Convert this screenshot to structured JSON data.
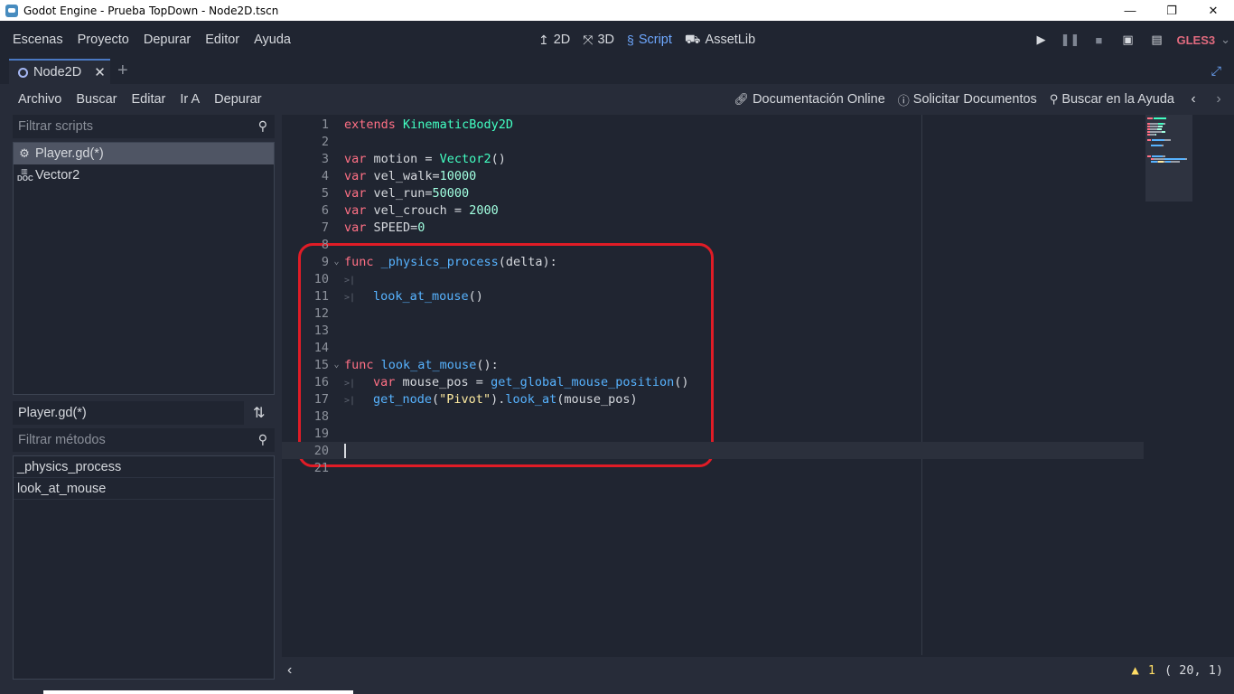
{
  "window": {
    "title": "Godot Engine - Prueba TopDown - Node2D.tscn",
    "controls": [
      "—",
      "❐",
      "✕"
    ]
  },
  "main_menu": [
    "Escenas",
    "Proyecto",
    "Depurar",
    "Editor",
    "Ayuda"
  ],
  "workspaces": [
    {
      "label": "2D",
      "icon": "2d-icon",
      "glyph": "↥"
    },
    {
      "label": "3D",
      "icon": "3d-icon",
      "glyph": "⤧"
    },
    {
      "label": "Script",
      "icon": "script-icon",
      "glyph": "§",
      "active": true
    },
    {
      "label": "AssetLib",
      "icon": "assetlib-icon",
      "glyph": "⛟"
    }
  ],
  "renderer": "GLES3",
  "scene_tab": {
    "name": "Node2D"
  },
  "script_menu": [
    "Archivo",
    "Buscar",
    "Editar",
    "Ir A",
    "Depurar"
  ],
  "help_links": {
    "online_docs": "Documentación Online",
    "request_docs": "Solicitar Documentos",
    "search_help": "Buscar en la Ayuda"
  },
  "scripts_panel": {
    "filter_placeholder": "Filtrar scripts",
    "items": [
      {
        "label": "Player.gd(*)",
        "icon": "gear-icon",
        "selected": true
      },
      {
        "label": "Vector2",
        "icon": "doc-icon",
        "selected": false
      }
    ]
  },
  "methods_panel": {
    "current_script": "Player.gd(*)",
    "filter_placeholder": "Filtrar métodos",
    "items": [
      "_physics_process",
      "look_at_mouse"
    ]
  },
  "code_lines": [
    {
      "n": "1",
      "tokens": [
        [
          "kw",
          "extends"
        ],
        [
          "plain",
          " "
        ],
        [
          "ty",
          "KinematicBody2D"
        ]
      ]
    },
    {
      "n": "2",
      "tokens": []
    },
    {
      "n": "3",
      "tokens": [
        [
          "kw",
          "var"
        ],
        [
          "plain",
          " motion = "
        ],
        [
          "ty",
          "Vector2"
        ],
        [
          "plain",
          "()"
        ]
      ]
    },
    {
      "n": "4",
      "tokens": [
        [
          "kw",
          "var"
        ],
        [
          "plain",
          " vel_walk="
        ],
        [
          "num",
          "10000"
        ]
      ]
    },
    {
      "n": "5",
      "tokens": [
        [
          "kw",
          "var"
        ],
        [
          "plain",
          " vel_run="
        ],
        [
          "num",
          "50000"
        ]
      ]
    },
    {
      "n": "6",
      "tokens": [
        [
          "kw",
          "var"
        ],
        [
          "plain",
          " vel_crouch = "
        ],
        [
          "num",
          "2000"
        ]
      ]
    },
    {
      "n": "7",
      "tokens": [
        [
          "kw",
          "var"
        ],
        [
          "plain",
          " SPEED="
        ],
        [
          "num",
          "0"
        ]
      ]
    },
    {
      "n": "8",
      "tokens": []
    },
    {
      "n": "9",
      "fold": true,
      "tokens": [
        [
          "kw",
          "func"
        ],
        [
          "plain",
          " "
        ],
        [
          "fn",
          "_physics_process"
        ],
        [
          "plain",
          "(delta):"
        ]
      ]
    },
    {
      "n": "10",
      "tokens": [
        [
          "tab",
          ">|"
        ]
      ]
    },
    {
      "n": "11",
      "tokens": [
        [
          "tab",
          ">|"
        ],
        [
          "fn",
          "look_at_mouse"
        ],
        [
          "plain",
          "()"
        ]
      ]
    },
    {
      "n": "12",
      "tokens": []
    },
    {
      "n": "13",
      "tokens": []
    },
    {
      "n": "14",
      "tokens": []
    },
    {
      "n": "15",
      "fold": true,
      "tokens": [
        [
          "kw",
          "func"
        ],
        [
          "plain",
          " "
        ],
        [
          "fn",
          "look_at_mouse"
        ],
        [
          "plain",
          "():"
        ]
      ]
    },
    {
      "n": "16",
      "tokens": [
        [
          "tab",
          ">|"
        ],
        [
          "kw",
          "var"
        ],
        [
          "plain",
          " mouse_pos = "
        ],
        [
          "fn",
          "get_global_mouse_position"
        ],
        [
          "plain",
          "()"
        ]
      ]
    },
    {
      "n": "17",
      "tokens": [
        [
          "tab",
          ">|"
        ],
        [
          "fn",
          "get_node"
        ],
        [
          "plain",
          "("
        ],
        [
          "str",
          "\"Pivot\""
        ],
        [
          "plain",
          ")."
        ],
        [
          "fn",
          "look_at"
        ],
        [
          "plain",
          "(mouse_pos)"
        ]
      ]
    },
    {
      "n": "18",
      "tokens": []
    },
    {
      "n": "19",
      "tokens": []
    },
    {
      "n": "20",
      "current": true,
      "caret": true,
      "tokens": []
    },
    {
      "n": "21",
      "tokens": []
    }
  ],
  "status": {
    "warnings": "1",
    "position": "( 20,  1)"
  },
  "colors": {
    "keyword": "#ff7085",
    "type": "#42ffc2",
    "function": "#57b3ff",
    "number": "#a1ffe0",
    "string": "#ffeca1",
    "annotation_box": "#e01c26"
  }
}
